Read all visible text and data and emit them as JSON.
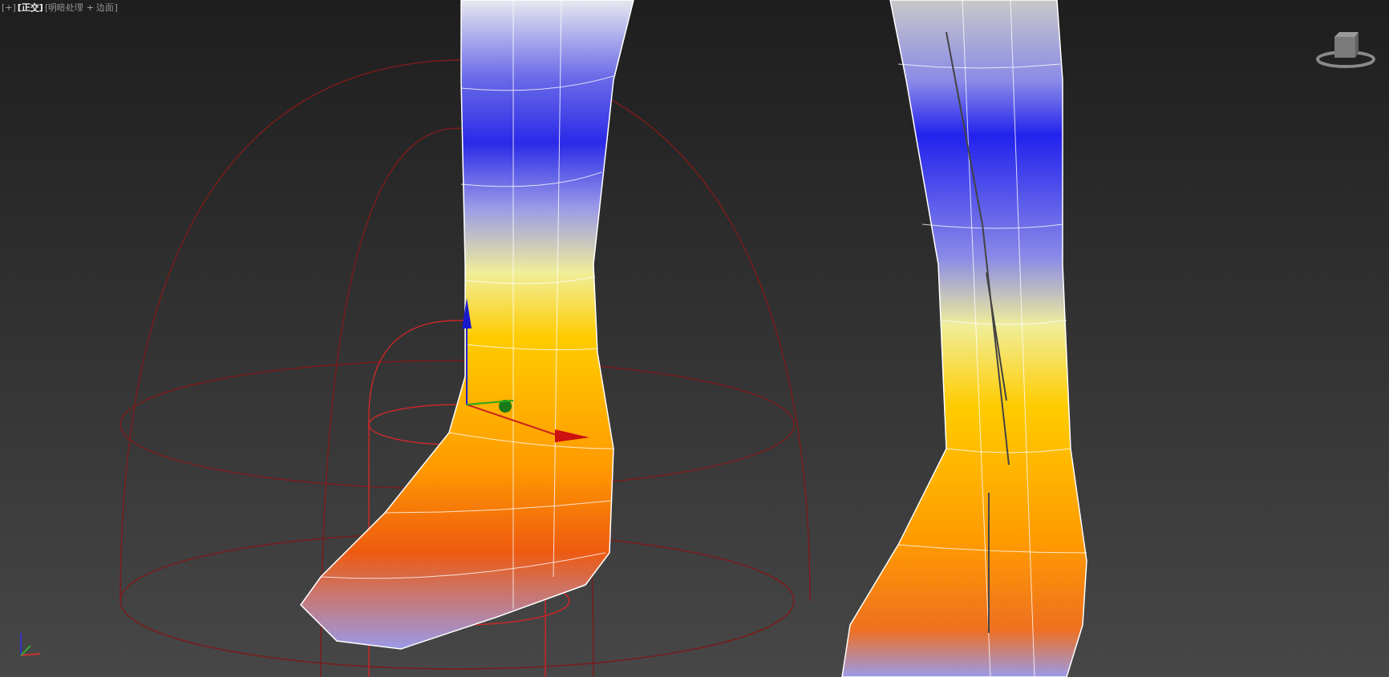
{
  "viewport": {
    "labels": [
      {
        "text": "[+]",
        "highlighted": false
      },
      {
        "text": "[正交]",
        "highlighted": true
      },
      {
        "text": "[明暗处理 + 边面]",
        "highlighted": false
      }
    ]
  }
}
